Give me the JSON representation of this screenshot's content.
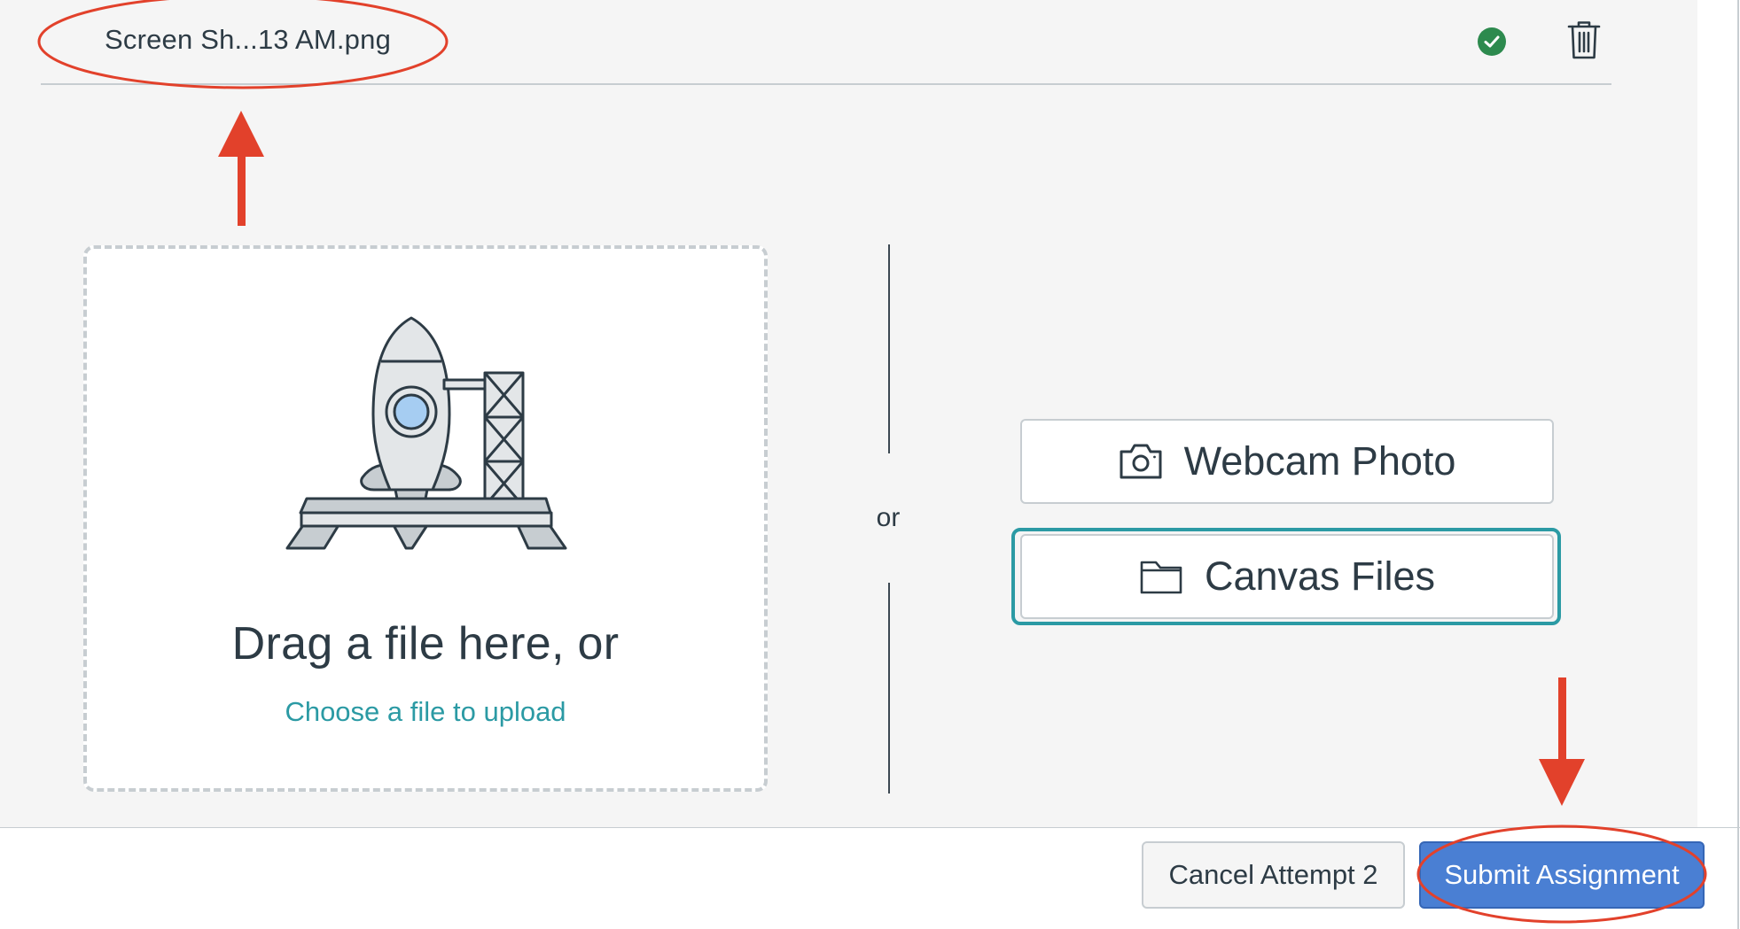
{
  "uploaded_file": {
    "name": "Screen Sh...13 AM.png"
  },
  "dropzone": {
    "heading": "Drag a file here, or",
    "link": "Choose a file to upload"
  },
  "separator": {
    "label": "or"
  },
  "buttons": {
    "webcam": "Webcam Photo",
    "canvas_files": "Canvas Files"
  },
  "footer": {
    "cancel": "Cancel Attempt 2",
    "submit": "Submit Assignment"
  },
  "icons": {
    "upload_complete": "check-circle-icon",
    "delete": "trash-icon",
    "webcam": "camera-icon",
    "canvas_files": "folder-icon",
    "dropzone": "rocket-launch-illustration"
  },
  "colors": {
    "success": "#2d8a4e",
    "link": "#2b9aa4",
    "focus": "#2b9aa4",
    "submit": "#4a7fd3",
    "annotation": "#e2412b"
  }
}
